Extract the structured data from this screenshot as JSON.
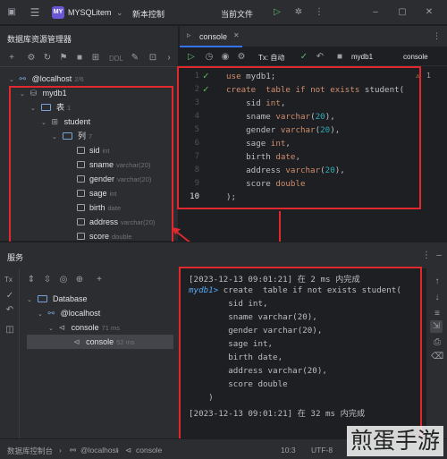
{
  "app": {
    "project_badge": "MY",
    "project_name": "MYSQLitem",
    "vcs_label": "新本控制",
    "current_file_label": "当前文件"
  },
  "db_explorer": {
    "title": "数据库资源管理器",
    "ddl_label": "DDL",
    "tree": {
      "host": {
        "label": "@localhost",
        "count": "2/6"
      },
      "schema": {
        "label": "mydb1"
      },
      "tables_folder": {
        "label": "表",
        "count": "1"
      },
      "table": {
        "label": "student"
      },
      "columns_folder": {
        "label": "列",
        "count": "7"
      },
      "columns": [
        {
          "name": "sid",
          "type": "int"
        },
        {
          "name": "sname",
          "type": "varchar(20)"
        },
        {
          "name": "gender",
          "type": "varchar(20)"
        },
        {
          "name": "sage",
          "type": "int"
        },
        {
          "name": "birth",
          "type": "date"
        },
        {
          "name": "address",
          "type": "varchar(20)"
        },
        {
          "name": "score",
          "type": "double"
        }
      ]
    }
  },
  "editor": {
    "tab_label": "console",
    "tx_label": "Tx: 自动",
    "schema_select": "mydb1",
    "console_select": "console",
    "warning_count": "1",
    "line_numbers": [
      "1",
      "2",
      "3",
      "4",
      "5",
      "6",
      "7",
      "8",
      "9",
      "10"
    ],
    "lines": [
      "use mydb1;",
      "create  table if not exists student(",
      "    sid int,",
      "    sname varchar(20),",
      "    gender varchar(20),",
      "    sage int,",
      "    birth date,",
      "    address varchar(20),",
      "    score double",
      ");"
    ]
  },
  "services": {
    "title": "服务",
    "tree": {
      "database": "Database",
      "host": "@localhost",
      "console": {
        "label": "console",
        "time": "71 ms"
      },
      "console_child": {
        "label": "console",
        "time": "52 ms"
      }
    },
    "output": {
      "line1": "[2023-12-13 09:01:21] 在 2 ms 内完成",
      "prompt": "mydb1>",
      "stmt": " create  table if not exists student(",
      "body": [
        "        sid int,",
        "        sname varchar(20),",
        "        gender varchar(20),",
        "        sage int,",
        "        birth date,",
        "        address varchar(20),",
        "        score double",
        "    )"
      ],
      "line_last": "[2023-12-13 09:01:21] 在 32 ms 内完成"
    }
  },
  "statusbar": {
    "crumb1": "数据库控制台",
    "crumb2": "@localhost",
    "crumb3": "console",
    "position": "10:3",
    "encoding": "UTF-8"
  },
  "watermark": "煎蛋手游",
  "colors": {
    "highlight_box": "#e0282e",
    "keyword": "#cf8e6d",
    "number": "#2aacb8",
    "accent": "#6b57d6"
  }
}
